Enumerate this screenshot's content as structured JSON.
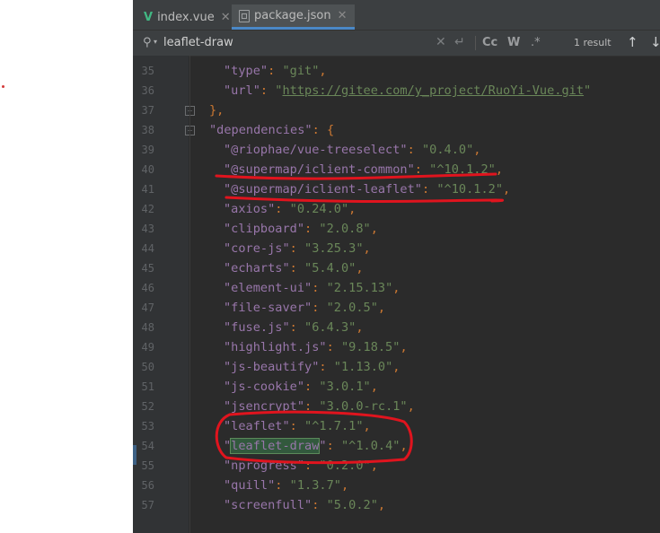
{
  "tabs": [
    {
      "label": "index.vue",
      "icon": "vue-icon",
      "active": false
    },
    {
      "label": "package.json",
      "icon": "npm-file-icon",
      "active": true
    }
  ],
  "search": {
    "term": "leaflet-draw",
    "case_label": "Cc",
    "word_label": "W",
    "regex_label": ".*",
    "result_count": "1 result"
  },
  "editor": {
    "lines": [
      {
        "no": "35",
        "segments": [
          {
            "t": "\"type\"",
            "c": "key"
          },
          {
            "t": ": ",
            "c": "pun"
          },
          {
            "t": "\"git\"",
            "c": "str"
          },
          {
            "t": ",",
            "c": "pun"
          }
        ],
        "indent": 2
      },
      {
        "no": "36",
        "segments": [
          {
            "t": "\"url\"",
            "c": "key"
          },
          {
            "t": ": ",
            "c": "pun"
          },
          {
            "t": "\"",
            "c": "str"
          },
          {
            "t": "https://gitee.com/y_project/RuoYi-Vue.git",
            "c": "url"
          },
          {
            "t": "\"",
            "c": "str"
          }
        ],
        "indent": 2
      },
      {
        "no": "37",
        "segments": [
          {
            "t": "},",
            "c": "pun"
          }
        ],
        "indent": 1,
        "fold": true
      },
      {
        "no": "38",
        "segments": [
          {
            "t": "\"dependencies\"",
            "c": "key"
          },
          {
            "t": ": {",
            "c": "pun"
          }
        ],
        "indent": 1,
        "fold": true
      },
      {
        "no": "39",
        "segments": [
          {
            "t": "\"@riophae/vue-treeselect\"",
            "c": "key"
          },
          {
            "t": ": ",
            "c": "pun"
          },
          {
            "t": "\"0.4.0\"",
            "c": "str"
          },
          {
            "t": ",",
            "c": "pun"
          }
        ],
        "indent": 2
      },
      {
        "no": "40",
        "segments": [
          {
            "t": "\"@supermap/iclient-common\"",
            "c": "key"
          },
          {
            "t": ": ",
            "c": "pun"
          },
          {
            "t": "\"^10.1.2\"",
            "c": "str"
          },
          {
            "t": ",",
            "c": "pun"
          }
        ],
        "indent": 2
      },
      {
        "no": "41",
        "segments": [
          {
            "t": "\"@supermap/iclient-leaflet\"",
            "c": "key"
          },
          {
            "t": ": ",
            "c": "pun"
          },
          {
            "t": "\"^10.1.2\"",
            "c": "str"
          },
          {
            "t": ",",
            "c": "pun"
          }
        ],
        "indent": 2
      },
      {
        "no": "42",
        "segments": [
          {
            "t": "\"axios\"",
            "c": "key"
          },
          {
            "t": ": ",
            "c": "pun"
          },
          {
            "t": "\"0.24.0\"",
            "c": "str"
          },
          {
            "t": ",",
            "c": "pun"
          }
        ],
        "indent": 2
      },
      {
        "no": "43",
        "segments": [
          {
            "t": "\"clipboard\"",
            "c": "key"
          },
          {
            "t": ": ",
            "c": "pun"
          },
          {
            "t": "\"2.0.8\"",
            "c": "str"
          },
          {
            "t": ",",
            "c": "pun"
          }
        ],
        "indent": 2
      },
      {
        "no": "44",
        "segments": [
          {
            "t": "\"core-js\"",
            "c": "key"
          },
          {
            "t": ": ",
            "c": "pun"
          },
          {
            "t": "\"3.25.3\"",
            "c": "str"
          },
          {
            "t": ",",
            "c": "pun"
          }
        ],
        "indent": 2
      },
      {
        "no": "45",
        "segments": [
          {
            "t": "\"echarts\"",
            "c": "key"
          },
          {
            "t": ": ",
            "c": "pun"
          },
          {
            "t": "\"5.4.0\"",
            "c": "str"
          },
          {
            "t": ",",
            "c": "pun"
          }
        ],
        "indent": 2
      },
      {
        "no": "46",
        "segments": [
          {
            "t": "\"element-ui\"",
            "c": "key"
          },
          {
            "t": ": ",
            "c": "pun"
          },
          {
            "t": "\"2.15.13\"",
            "c": "str"
          },
          {
            "t": ",",
            "c": "pun"
          }
        ],
        "indent": 2
      },
      {
        "no": "47",
        "segments": [
          {
            "t": "\"file-saver\"",
            "c": "key"
          },
          {
            "t": ": ",
            "c": "pun"
          },
          {
            "t": "\"2.0.5\"",
            "c": "str"
          },
          {
            "t": ",",
            "c": "pun"
          }
        ],
        "indent": 2
      },
      {
        "no": "48",
        "segments": [
          {
            "t": "\"fuse.js\"",
            "c": "key"
          },
          {
            "t": ": ",
            "c": "pun"
          },
          {
            "t": "\"6.4.3\"",
            "c": "str"
          },
          {
            "t": ",",
            "c": "pun"
          }
        ],
        "indent": 2
      },
      {
        "no": "49",
        "segments": [
          {
            "t": "\"highlight.js\"",
            "c": "key"
          },
          {
            "t": ": ",
            "c": "pun"
          },
          {
            "t": "\"9.18.5\"",
            "c": "str"
          },
          {
            "t": ",",
            "c": "pun"
          }
        ],
        "indent": 2
      },
      {
        "no": "50",
        "segments": [
          {
            "t": "\"js-beautify\"",
            "c": "key"
          },
          {
            "t": ": ",
            "c": "pun"
          },
          {
            "t": "\"1.13.0\"",
            "c": "str"
          },
          {
            "t": ",",
            "c": "pun"
          }
        ],
        "indent": 2
      },
      {
        "no": "51",
        "segments": [
          {
            "t": "\"js-cookie\"",
            "c": "key"
          },
          {
            "t": ": ",
            "c": "pun"
          },
          {
            "t": "\"3.0.1\"",
            "c": "str"
          },
          {
            "t": ",",
            "c": "pun"
          }
        ],
        "indent": 2
      },
      {
        "no": "52",
        "segments": [
          {
            "t": "\"jsencrypt\"",
            "c": "key"
          },
          {
            "t": ": ",
            "c": "pun"
          },
          {
            "t": "\"3.0.0-rc.1\"",
            "c": "str"
          },
          {
            "t": ",",
            "c": "pun"
          }
        ],
        "indent": 2
      },
      {
        "no": "53",
        "segments": [
          {
            "t": "\"leaflet\"",
            "c": "key"
          },
          {
            "t": ": ",
            "c": "pun"
          },
          {
            "t": "\"^1.7.1\"",
            "c": "str"
          },
          {
            "t": ",",
            "c": "pun"
          }
        ],
        "indent": 2
      },
      {
        "no": "54",
        "segments": [
          {
            "t": "\"",
            "c": "key"
          },
          {
            "t": "leaflet-draw",
            "c": "hl"
          },
          {
            "t": "\"",
            "c": "key"
          },
          {
            "t": ": ",
            "c": "pun"
          },
          {
            "t": "\"^1.0.4\"",
            "c": "str"
          },
          {
            "t": ",",
            "c": "pun"
          }
        ],
        "indent": 2
      },
      {
        "no": "55",
        "segments": [
          {
            "t": "\"nprogress\"",
            "c": "key"
          },
          {
            "t": ": ",
            "c": "pun"
          },
          {
            "t": "\"0.2.0\"",
            "c": "str"
          },
          {
            "t": ",",
            "c": "pun"
          }
        ],
        "indent": 2
      },
      {
        "no": "56",
        "segments": [
          {
            "t": "\"quill\"",
            "c": "key"
          },
          {
            "t": ": ",
            "c": "pun"
          },
          {
            "t": "\"1.3.7\"",
            "c": "str"
          },
          {
            "t": ",",
            "c": "pun"
          }
        ],
        "indent": 2
      },
      {
        "no": "57",
        "segments": [
          {
            "t": "\"screenfull\"",
            "c": "key"
          },
          {
            "t": ": ",
            "c": "pun"
          },
          {
            "t": "\"5.0.2\"",
            "c": "str"
          },
          {
            "t": ",",
            "c": "pun"
          }
        ],
        "indent": 2
      }
    ]
  },
  "colors": {
    "annotation_red": "#e0141e",
    "key": "#9876aa",
    "string": "#6a8759",
    "punct": "#cc7832"
  }
}
